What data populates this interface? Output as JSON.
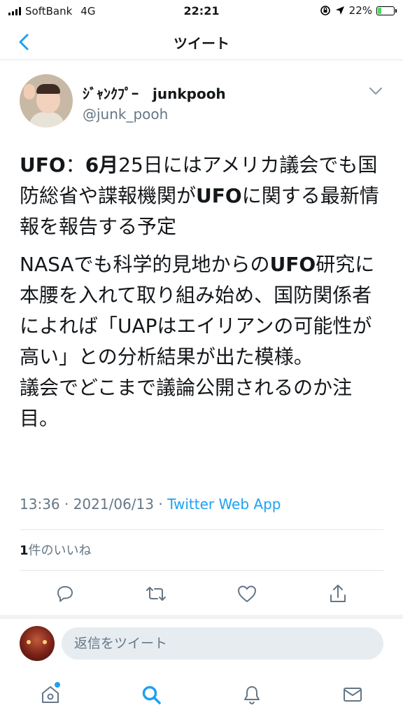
{
  "status_bar": {
    "carrier": "SoftBank",
    "network": "4G",
    "time": "22:21",
    "battery_percent": "22%",
    "battery_level": 0.22
  },
  "nav": {
    "title": "ツイート"
  },
  "tweet": {
    "display_name": "ｼﾞｬﾝｸﾌﾟｰ　junkpooh",
    "handle": "@junk_pooh",
    "text_p1": [
      {
        "t": "UFO",
        "bold": true
      },
      {
        "t": "：",
        "bold": false
      },
      {
        "t": "6月",
        "bold": true
      },
      {
        "t": "25日にはアメリカ議会でも国防総省や諜報機関が",
        "bold": false
      },
      {
        "t": "UFO",
        "bold": true
      },
      {
        "t": "に関する最新情報を報告する予定",
        "bold": false
      }
    ],
    "text_p2": [
      {
        "t": "NASAでも科学的見地からの",
        "bold": false
      },
      {
        "t": "UFO",
        "bold": true
      },
      {
        "t": "研究に本腰を入れて取り組み始め、国防関係者によれば「UAPはエイリアンの可能性が高い」との分析結果が出た模様。",
        "bold": false
      }
    ],
    "text_p3": [
      {
        "t": "議会でどこまで議論公開されるのか注目。",
        "bold": false
      }
    ],
    "timestamp": "13:36 · 2021/06/13 · ",
    "source": "Twitter Web App",
    "likes_count": "1",
    "likes_label": "件のいいね"
  },
  "reply": {
    "placeholder": "返信をツイート"
  },
  "colors": {
    "accent": "#1da1f2",
    "muted": "#657786",
    "divider": "#e1e8ed"
  }
}
